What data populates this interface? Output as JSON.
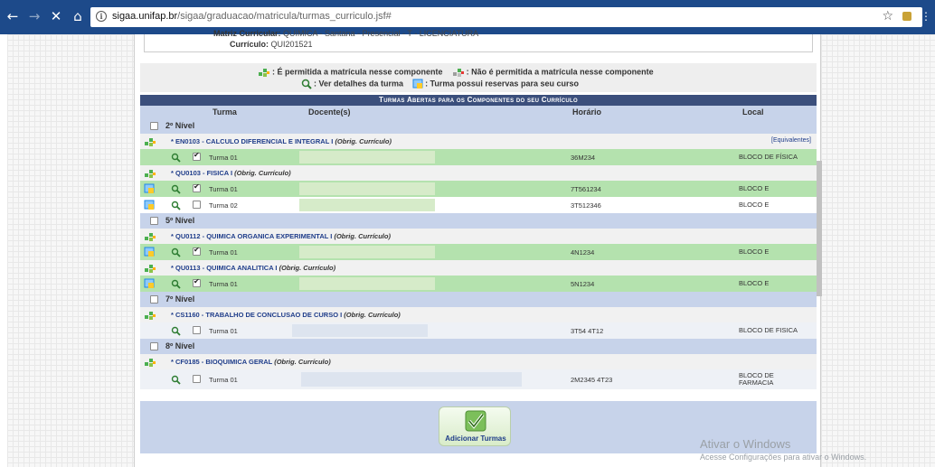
{
  "browser": {
    "back": "←",
    "forward": "→",
    "stop": "✕",
    "home": "⌂",
    "url_host": "sigaa.unifap.br",
    "url_path": "/sigaa/graduacao/matricula/turmas_curriculo.jsf#",
    "star": "☆",
    "menu": "⋮"
  },
  "matrix": {
    "matriz_label": "Matriz Curricular:",
    "matriz_value": "QUIMICA - Santana - Presencial - T - LICENCIATURA",
    "curriculo_label": "Currículo:",
    "curriculo_value": "QUI201521"
  },
  "legend": {
    "permitida": ": É permitida a matrícula nesse componente",
    "nao_permitida": ": Não é permitida a matrícula nesse componente",
    "detalhes": ": Ver detalhes da turma",
    "reservas": ": Turma possui reservas para seu curso"
  },
  "table": {
    "caption": "Turmas Abertas para os Componentes do seu Currículo",
    "headers": {
      "turma": "Turma",
      "docente": "Docente(s)",
      "horario": "Horário",
      "local": "Local"
    },
    "levels": [
      {
        "label": "2º Nível"
      },
      {
        "label": "5º Nível"
      },
      {
        "label": "7º Nível"
      },
      {
        "label": "8º Nível"
      }
    ],
    "components": [
      {
        "code": "* EN0103 - CALCULO DIFERENCIAL E INTEGRAL I",
        "obrig": "(Obrig. Currículo)",
        "equiv": "[Equivalentes]"
      },
      {
        "code": "* QU0103 - FISICA I",
        "obrig": "(Obrig. Currículo)"
      },
      {
        "code": "* QU0112 - QUIMICA ORGANICA EXPERIMENTAL I",
        "obrig": "(Obrig. Currículo)"
      },
      {
        "code": "* QU0113 - QUIMICA ANALITICA I",
        "obrig": "(Obrig. Currículo)"
      },
      {
        "code": "* CS1160 - TRABALHO DE CONCLUSAO DE CURSO I",
        "obrig": "(Obrig. Currículo)"
      },
      {
        "code": "* CF0185 - BIOQUIMICA GERAL",
        "obrig": "(Obrig. Currículo)"
      }
    ],
    "turmas": [
      {
        "name": "Turma 01",
        "horario": "36M234",
        "local": "BLOCO DE FÍSICA",
        "checked": true
      },
      {
        "name": "Turma 01",
        "horario": "7T561234",
        "local": "BLOCO E",
        "checked": true
      },
      {
        "name": "Turma 02",
        "horario": "3T512346",
        "local": "BLOCO E",
        "checked": false
      },
      {
        "name": "Turma 01",
        "horario": "4N1234",
        "local": "BLOCO E",
        "checked": true
      },
      {
        "name": "Turma 01",
        "horario": "5N1234",
        "local": "BLOCO E",
        "checked": true
      },
      {
        "name": "Turma 01",
        "horario": "3T54 4T12",
        "local": "BLOCO DE FISICA",
        "checked": false
      },
      {
        "name": "Turma 01",
        "horario": "2M2345 4T23",
        "local_line1": "BLOCO DE",
        "local_line2": "FARMACIA",
        "checked": false
      }
    ]
  },
  "footer": {
    "add_button": "Adicionar Turmas"
  },
  "watermark": {
    "title": "Ativar o Windows",
    "subtitle": "Acesse Configurações para ativar o Windows."
  },
  "colors": {
    "chrome": "#1d4a8a",
    "caption_bg": "#3b4f7c",
    "level_bg": "#c7d3ea",
    "enrolled_row": "#b4e2ae",
    "link": "#1f3d8a"
  }
}
